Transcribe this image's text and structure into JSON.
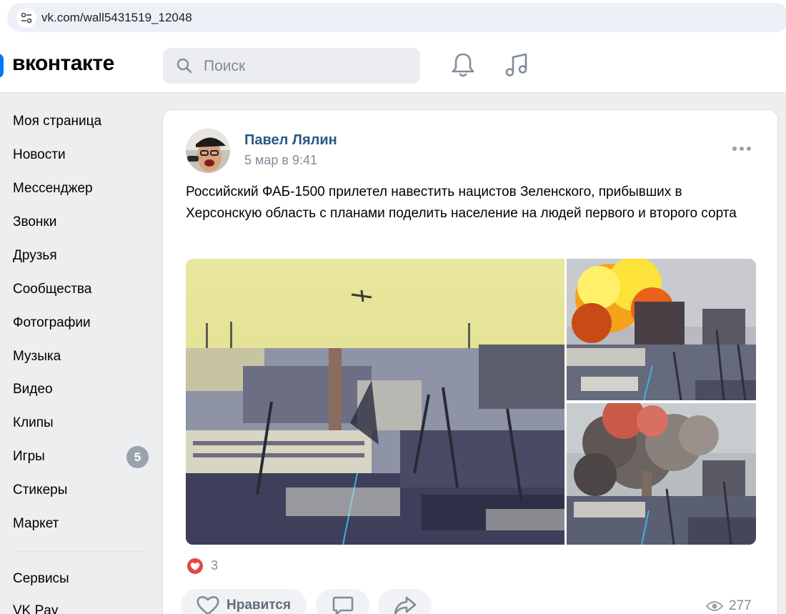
{
  "browser": {
    "url": "vk.com/wall5431519_12048"
  },
  "header": {
    "logo_text": "вконтакте",
    "search_placeholder": "Поиск",
    "accent_color": "#0077ff"
  },
  "sidebar": {
    "items": [
      {
        "label": "Моя страница"
      },
      {
        "label": "Новости"
      },
      {
        "label": "Мессенджер"
      },
      {
        "label": "Звонки"
      },
      {
        "label": "Друзья"
      },
      {
        "label": "Сообщества"
      },
      {
        "label": "Фотографии"
      },
      {
        "label": "Музыка"
      },
      {
        "label": "Видео"
      },
      {
        "label": "Клипы"
      },
      {
        "label": "Игры",
        "badge": "5"
      },
      {
        "label": "Стикеры"
      },
      {
        "label": "Маркет"
      }
    ],
    "secondary_items": [
      {
        "label": "Сервисы"
      },
      {
        "label": "VK Pay"
      }
    ]
  },
  "post": {
    "author": "Павел Лялин",
    "date": "5 мар в 9:41",
    "text": "Российский ФАБ-1500 прилетел навестить нацистов Зеленского, прибывших в Херсонскую область с планами поделить население на людей первого и второго сорта",
    "reactions_count": "3",
    "like_label": "Нравится",
    "views": "277",
    "photos": [
      {
        "name": "aircraft-over-city"
      },
      {
        "name": "explosion-fireball"
      },
      {
        "name": "explosion-smoke"
      }
    ]
  }
}
